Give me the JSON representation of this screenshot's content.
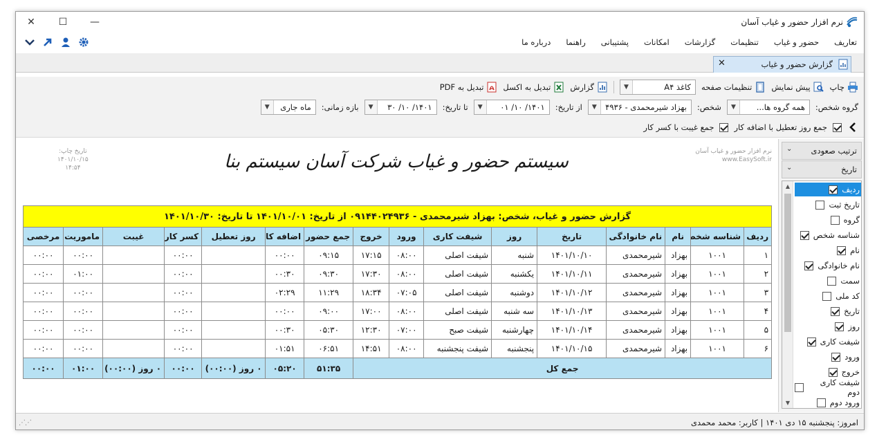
{
  "window": {
    "title": "نرم افزار حضور و غیاب آسان"
  },
  "menu": [
    "تعاریف",
    "حضور و غیاب",
    "تنظیمات",
    "گزارشات",
    "امکانات",
    "پشتیبانی",
    "راهنما",
    "درباره ما"
  ],
  "tab": {
    "label": "گزارش حضور و غیاب"
  },
  "toolbar": {
    "print": "چاپ",
    "preview": "پیش نمایش",
    "page_settings": "تنظیمات صفحه",
    "paper_size": "کاغذ A۴",
    "report": "گزارش",
    "to_excel": "تبدیل به اکسل",
    "to_pdf": "تبدیل به PDF",
    "person_group_label": "گروه شخص:",
    "person_group_value": "همه گروه ها...",
    "person_label": "شخص:",
    "person_value": "بهزاد شیرمحمدی - ۴۹۳۶",
    "from_date_label": "از تاریخ:",
    "from_date_value": "۱۴۰۱/ ۱۰/ ۰۱",
    "to_date_label": "تا تاریخ:",
    "to_date_value": "۱۴۰۱/ ۱۰/ ۳۰",
    "time_span_label": "بازه زمانی:",
    "time_span_value": "ماه جاری",
    "holiday_sum_label": "جمع روز تعطیل با اضافه کار",
    "holiday_sum_checked": true,
    "absence_sum_label": "جمع غیبت با کسر کار",
    "absence_sum_checked": true
  },
  "report": {
    "title": "سیستم حضور و غیاب شرکت آسان سیستم بنا",
    "print_date_label": "تاریخ چاپ:",
    "print_date": "۱۴۰۱/۱۰/۱۵",
    "print_time": "۱۴:۵۴",
    "software_name": "نرم افزار حضور و غیاب آسان",
    "website": "www.EasySoft.ir",
    "caption": "گزارش حضور و غیاب، شخص: بهزاد شیرمحمدی - ۰۹۱۴۴۰۲۴۹۳۶ از تاریخ: ۱۴۰۱/۱۰/۰۱ تا تاریخ: ۱۴۰۱/۱۰/۳۰",
    "columns": [
      "ردیف",
      "شناسه شخص",
      "نام",
      "نام خانوادگی",
      "تاریخ",
      "روز",
      "شیفت کاری",
      "ورود",
      "خروج",
      "جمع حضور",
      "اضافه کار",
      "روز تعطیل",
      "کسر کار",
      "غیبت",
      "ماموریت",
      "مرخصی"
    ],
    "rows": [
      [
        "۱",
        "۱۰۰۱",
        "بهزاد",
        "شیرمحمدی",
        "۱۴۰۱/۱۰/۱۰",
        "شنبه",
        "شیفت اصلی",
        "۰۸:۰۰",
        "۱۷:۱۵",
        "۰۹:۱۵",
        "۰۰:۰۰",
        "",
        "۰۰:۰۰",
        "",
        "۰۰:۰۰",
        "۰۰:۰۰"
      ],
      [
        "۲",
        "۱۰۰۱",
        "بهزاد",
        "شیرمحمدی",
        "۱۴۰۱/۱۰/۱۱",
        "یکشنبه",
        "شیفت اصلی",
        "۰۸:۰۰",
        "۱۷:۳۰",
        "۰۹:۳۰",
        "۰۰:۳۰",
        "",
        "۰۰:۰۰",
        "",
        "۰۱:۰۰",
        "۰۰:۰۰"
      ],
      [
        "۳",
        "۱۰۰۱",
        "بهزاد",
        "شیرمحمدی",
        "۱۴۰۱/۱۰/۱۲",
        "دوشنبه",
        "شیفت اصلی",
        "۰۷:۰۵",
        "۱۸:۳۴",
        "۱۱:۲۹",
        "۰۲:۲۹",
        "",
        "۰۰:۰۰",
        "",
        "۰۰:۰۰",
        "۰۰:۰۰"
      ],
      [
        "۴",
        "۱۰۰۱",
        "بهزاد",
        "شیرمحمدی",
        "۱۴۰۱/۱۰/۱۳",
        "سه شنبه",
        "شیفت اصلی",
        "۰۸:۰۰",
        "۱۷:۰۰",
        "۰۹:۰۰",
        "۰۰:۰۰",
        "",
        "۰۰:۰۰",
        "",
        "۰۰:۰۰",
        "۰۰:۰۰"
      ],
      [
        "۵",
        "۱۰۰۱",
        "بهزاد",
        "شیرمحمدی",
        "۱۴۰۱/۱۰/۱۴",
        "چهارشنبه",
        "شیفت صبح",
        "۰۷:۰۰",
        "۱۲:۳۰",
        "۰۵:۳۰",
        "۰۰:۳۰",
        "",
        "۰۰:۰۰",
        "",
        "۰۰:۰۰",
        "۰۰:۰۰"
      ],
      [
        "۶",
        "۱۰۰۱",
        "بهزاد",
        "شیرمحمدی",
        "۱۴۰۱/۱۰/۱۵",
        "پنجشنبه",
        "شیفت پنجشنبه",
        "۰۸:۰۰",
        "۱۴:۵۱",
        "۰۶:۵۱",
        "۰۱:۵۱",
        "",
        "۰۰:۰۰",
        "",
        "۰۰:۰۰",
        "۰۰:۰۰"
      ]
    ],
    "total": {
      "label": "جمع کل",
      "attendance": "۵۱:۳۵",
      "overtime": "۰۵:۲۰",
      "holiday": "۰ روز (۰۰:۰۰)",
      "deficit": "۰۰:۰۰",
      "absence": "۰ روز (۰۰:۰۰)",
      "mission": "۰۱:۰۰",
      "leave": "۰۰:۰۰"
    }
  },
  "side_panel": {
    "sort_direction": "ترتیب صعودی",
    "sort_field": "تاریخ",
    "columns": [
      {
        "label": "ردیف",
        "checked": true,
        "selected": true
      },
      {
        "label": "تاریخ ثبت",
        "checked": false
      },
      {
        "label": "گروه",
        "checked": false
      },
      {
        "label": "شناسه شخص",
        "checked": true
      },
      {
        "label": "نام",
        "checked": true
      },
      {
        "label": "نام خانوادگی",
        "checked": true
      },
      {
        "label": "سمت",
        "checked": false
      },
      {
        "label": "کد ملی",
        "checked": false
      },
      {
        "label": "تاریخ",
        "checked": true
      },
      {
        "label": "روز",
        "checked": true
      },
      {
        "label": "شیفت کاری",
        "checked": true
      },
      {
        "label": "ورود",
        "checked": true
      },
      {
        "label": "خروج",
        "checked": true
      },
      {
        "label": "شیفت کاری دوم",
        "checked": false
      },
      {
        "label": "ورود دوم",
        "checked": false
      }
    ]
  },
  "status": {
    "text": "امروز: پنجشنبه ۱۵ دی ۱۴۰۱  |  کاربر: محمد محمدی"
  },
  "colors": {
    "accent": "#1e8fe0",
    "caption_bg": "#ffff00",
    "header_bg": "#b7e1f3"
  }
}
